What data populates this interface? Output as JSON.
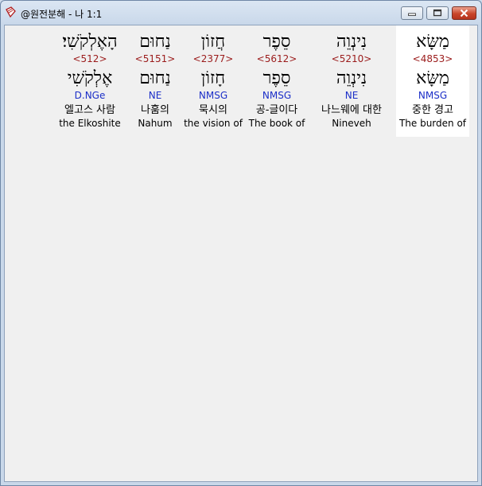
{
  "window": {
    "title": "@원전분해 - 나 1:1",
    "icon": "book-icon",
    "controls": {
      "minimize": "minimize-icon",
      "maximize": "maximize-icon",
      "close": "close-icon"
    }
  },
  "words": [
    {
      "hebrew": "מַשָּׂא",
      "strong": "<4853>",
      "lemma": "מַשָּׂא",
      "morph": "NMSG",
      "korean": "중한 경고",
      "english": "The burden of",
      "selected": true
    },
    {
      "hebrew": "נִינְוֵה",
      "strong": "<5210>",
      "lemma": "נִינְוֵה",
      "morph": "NE",
      "korean": "나느웨에 대한",
      "english": "Nineveh",
      "selected": false
    },
    {
      "hebrew": "סֵפֶר",
      "strong": "<5612>",
      "lemma": "סֵפֶר",
      "morph": "NMSG",
      "korean": "공-글이다",
      "english": "The book of",
      "selected": false
    },
    {
      "hebrew": "חֲזוֹן",
      "strong": "<2377>",
      "lemma": "חָזוֹן",
      "morph": "NMSG",
      "korean": "묵시의",
      "english": "the vision of",
      "selected": false
    },
    {
      "hebrew": "נַחוּם",
      "strong": "<5151>",
      "lemma": "נַחוּם",
      "morph": "NE",
      "korean": "나훔의",
      "english": "Nahum",
      "selected": false
    },
    {
      "hebrew": "הָאֶלְקֹשִׁי׃",
      "strong": "<512>",
      "lemma": "אֶלְקֹשִׁי",
      "morph": "D.NGe",
      "korean": "엘고스 사람",
      "english": "the Elkoshite",
      "selected": false
    }
  ]
}
